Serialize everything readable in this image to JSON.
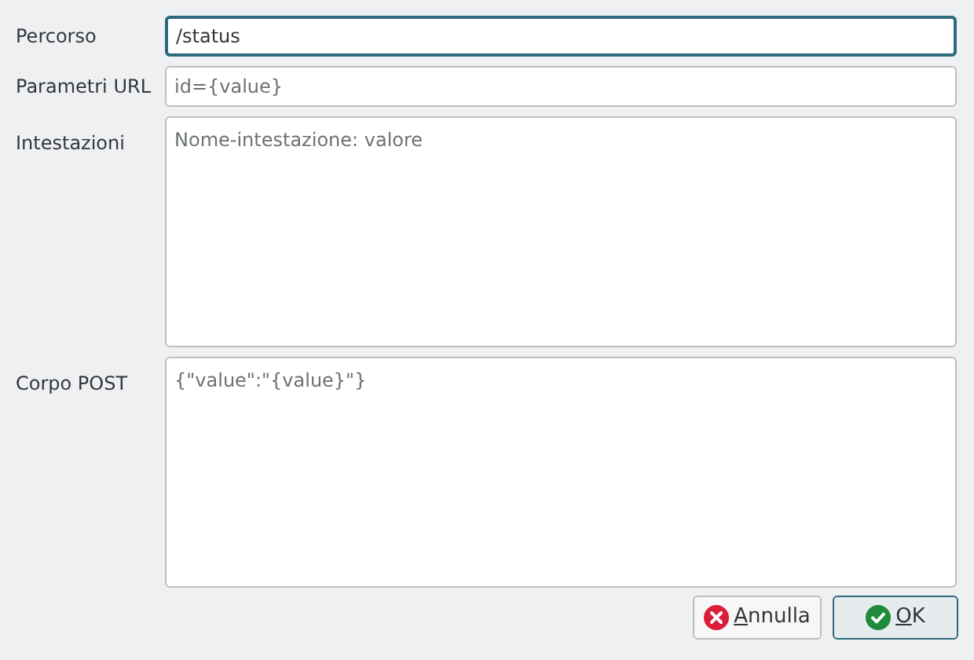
{
  "fields": [
    {
      "kind": "line",
      "label": "Percorso",
      "value": "/status",
      "focused": true
    },
    {
      "kind": "line",
      "label": "Parametri URL",
      "placeholder": "id={value}",
      "focused": false
    },
    {
      "kind": "area",
      "label": "Intestazioni",
      "placeholder": "Nome-intestazione: valore",
      "focused": false
    },
    {
      "kind": "area",
      "label": "Corpo POST",
      "placeholder": "{\"value\":\"{value}\"}",
      "focused": false
    }
  ],
  "buttons": [
    {
      "kind": "cancel",
      "label": "Annulla",
      "mnemonic_underlined": true,
      "default": false
    },
    {
      "kind": "ok",
      "label": "OK",
      "mnemonic_underlined": true,
      "default": true
    }
  ]
}
